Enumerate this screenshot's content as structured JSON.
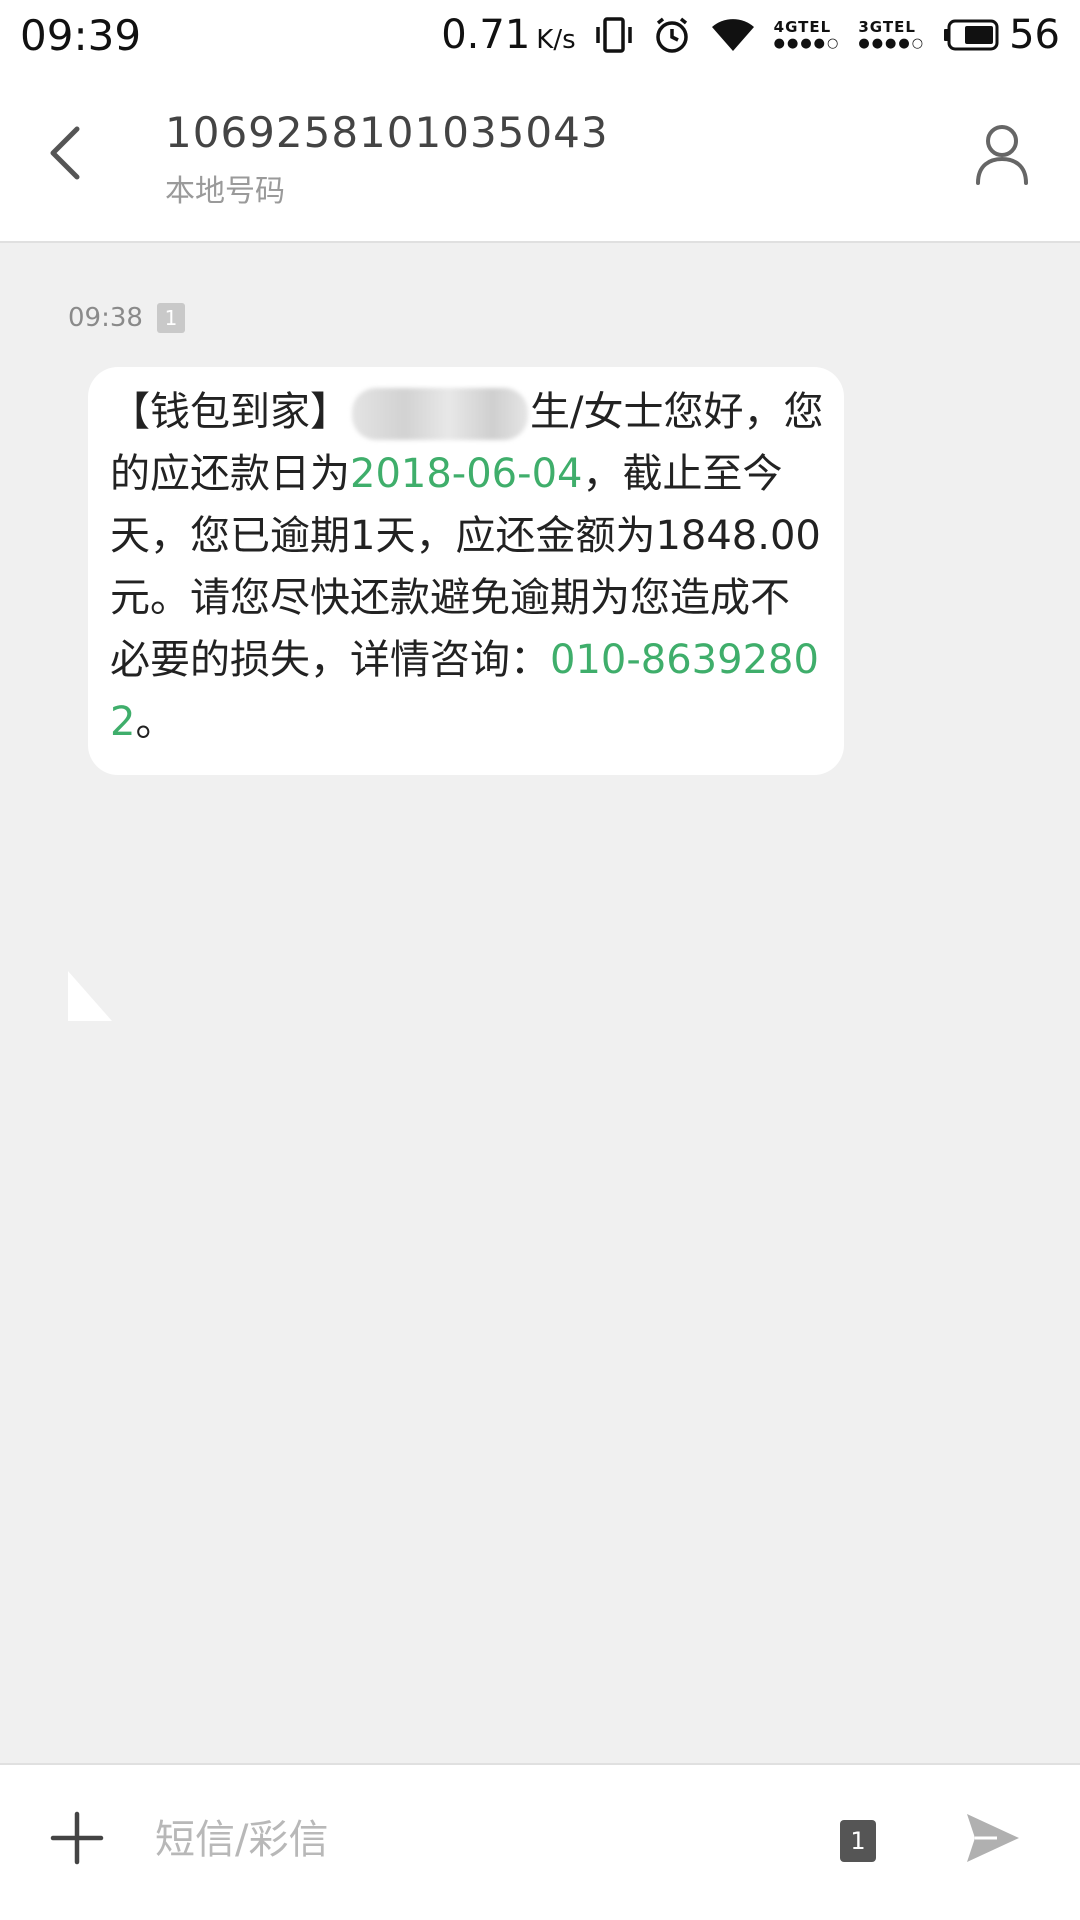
{
  "status_bar": {
    "time": "09:39",
    "net_speed": "0.71",
    "net_speed_unit": "K/s",
    "sim1_label": "4GTEL",
    "sim1_dots": "●●●●○",
    "sim2_label": "3GTEL",
    "sim2_dots": "●●●●○",
    "battery_percent": "56",
    "icons": [
      "vibrate-icon",
      "alarm-icon",
      "wifi-icon",
      "battery-icon"
    ]
  },
  "header": {
    "contact_number": "1069258101035043",
    "contact_subtitle": "本地号码",
    "icons": [
      "back-arrow-icon",
      "contact-person-icon"
    ]
  },
  "conversation": {
    "messages": [
      {
        "time": "09:38",
        "sim_badge": "1",
        "parts": {
          "p1": "【钱包到家】",
          "p2": "生/女士您好，您的应还款日为",
          "date_link": "2018-06-04",
          "p3": "，截止至今天，您已逾期1天，应还金额为1848.00元。请您尽快还款避免逾期为您造成不必要的损失，详情咨询：",
          "phone_link": "010-86392802",
          "p4": "。"
        }
      }
    ],
    "link_color": "#3fae6b"
  },
  "compose": {
    "placeholder": "短信/彩信",
    "sim_select": "1",
    "icons": [
      "add-icon",
      "send-icon"
    ]
  }
}
